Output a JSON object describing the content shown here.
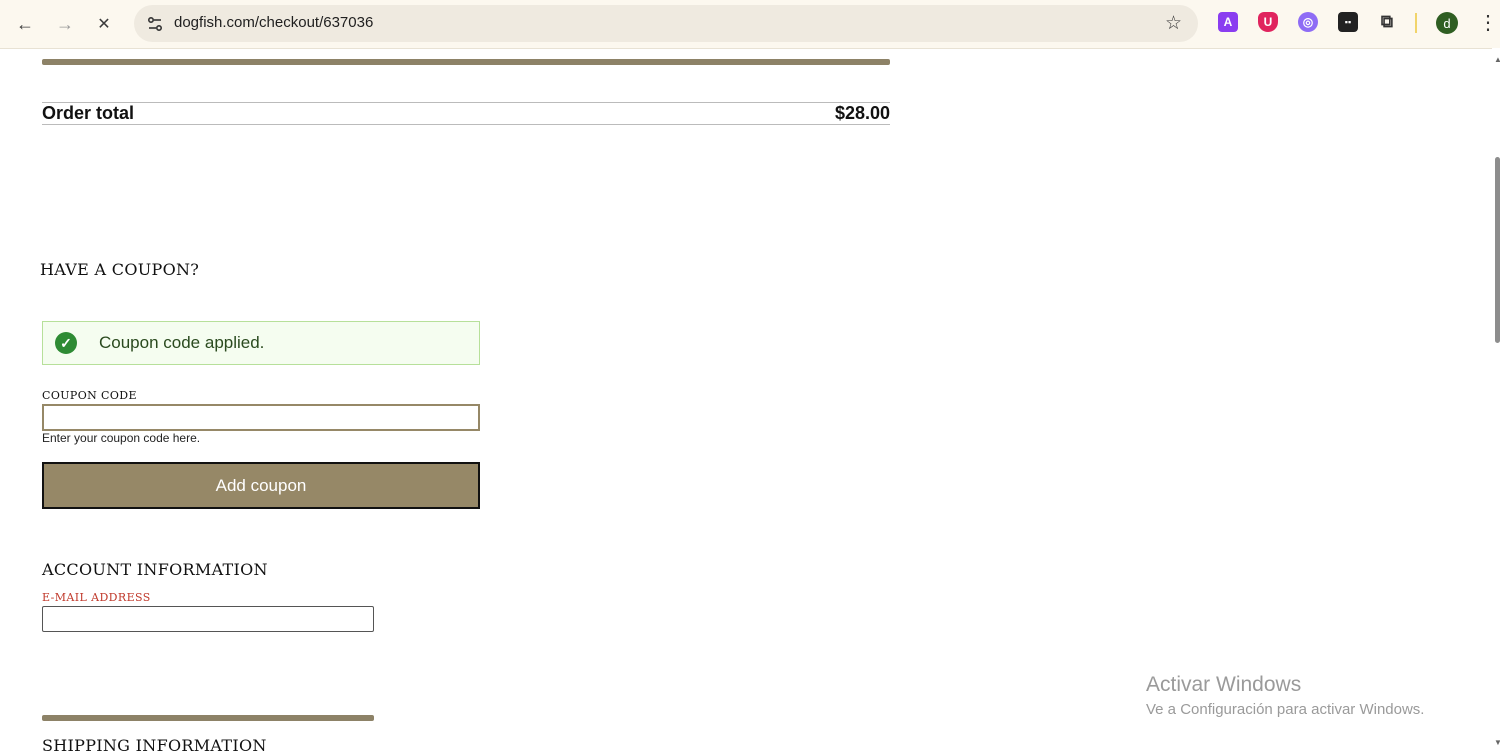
{
  "browser": {
    "url": "dogfish.com/checkout/637036",
    "nav_back": "←",
    "nav_forward": "→",
    "stop": "✕",
    "star": "☆",
    "avatar_initial": "d",
    "menu": "⋮",
    "extensions": [
      {
        "name": "translate-extension-icon",
        "glyph": "A",
        "color": "#8a3df0"
      },
      {
        "name": "ublock-extension-icon",
        "glyph": "U",
        "color": "#e0245e"
      },
      {
        "name": "purple-extension-icon",
        "glyph": "◎",
        "color": "#8e6cf5"
      },
      {
        "name": "tampermonkey-extension-icon",
        "glyph": "▪▪",
        "color": "#222222"
      },
      {
        "name": "extensions-puzzle-icon",
        "glyph": "⧉",
        "color": "#ffffff"
      }
    ]
  },
  "order": {
    "total_label": "Order total",
    "total_value": "$28.00"
  },
  "coupon": {
    "heading": "HAVE A COUPON?",
    "success_message": "Coupon code applied.",
    "field_label": "COUPON CODE",
    "field_value": "",
    "hint": "Enter your coupon code here.",
    "button_label": "Add coupon"
  },
  "account": {
    "heading": "ACCOUNT INFORMATION",
    "email_label": "E-MAIL ADDRESS",
    "email_value": ""
  },
  "shipping": {
    "heading": "SHIPPING INFORMATION"
  },
  "watermark": {
    "title": "Activar Windows",
    "subtitle": "Ve a Configuración para activar Windows."
  },
  "colors": {
    "accent": "#968867",
    "success_bg": "#f5fdf0",
    "success_border": "#b7e09a",
    "required_label": "#c0392b"
  }
}
